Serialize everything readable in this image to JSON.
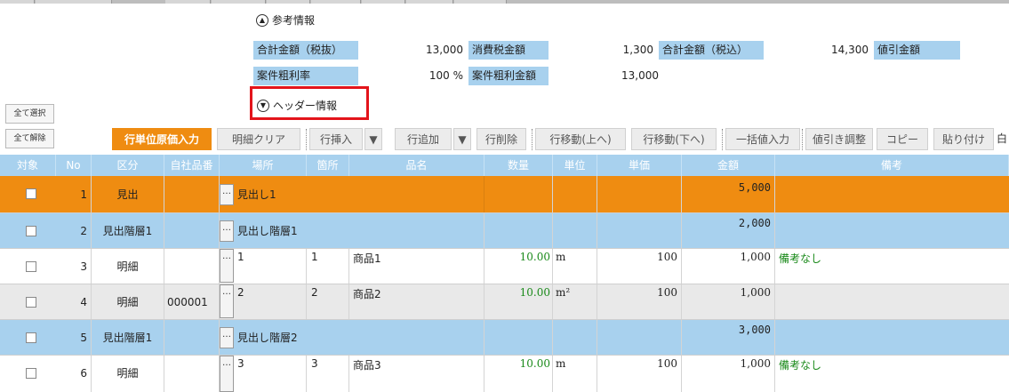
{
  "reference_section": {
    "title": "参考情報"
  },
  "summary": {
    "subtotal_label": "合計金額（税抜）",
    "subtotal_value": "13,000",
    "tax_label": "消費税金額",
    "tax_value": "1,300",
    "total_label": "合計金額（税込）",
    "total_value": "14,300",
    "discount_label": "値引金額",
    "margin_rate_label": "案件粗利率",
    "margin_rate_value": "100 %",
    "margin_amount_label": "案件粗利金額",
    "margin_amount_value": "13,000"
  },
  "header_section": {
    "title": "ヘッダー情報"
  },
  "left_buttons": {
    "select_all": "全て選択",
    "deselect_all": "全て解除"
  },
  "toolbar": {
    "cost_input": "行単位原価入力",
    "clear_details": "明細クリア",
    "insert_row": "行挿入",
    "add_row": "行追加",
    "delete_row": "行削除",
    "move_up": "行移動(上へ)",
    "move_down": "行移動(下へ)",
    "bulk_input": "一括値入力",
    "discount_adjust": "値引き調整",
    "copy": "コピー",
    "paste": "貼り付け",
    "overflow": "白"
  },
  "grid": {
    "headers": {
      "target": "対象",
      "no": "No",
      "category": "区分",
      "product_code": "自社品番",
      "place": "場所",
      "location": "箇所",
      "item_name": "品名",
      "quantity": "数量",
      "unit": "単位",
      "unit_price": "単価",
      "amount": "金額",
      "remarks": "備考"
    },
    "rows": [
      {
        "no": "1",
        "category": "見出",
        "place": "見出し1",
        "amount": "5,000",
        "style": "orange"
      },
      {
        "no": "2",
        "category": "見出階層1",
        "place": "見出し階層1",
        "amount": "2,000",
        "style": "blue"
      },
      {
        "no": "3",
        "category": "明細",
        "product_code": "",
        "place": "1",
        "location": "1",
        "item_name": "商品1",
        "quantity": "10.00",
        "unit": "m",
        "unit_price": "100",
        "amount": "1,000",
        "remarks": "備考なし",
        "style": "white"
      },
      {
        "no": "4",
        "category": "明細",
        "product_code": "000001",
        "place": "2",
        "location": "2",
        "item_name": "商品2",
        "quantity": "10.00",
        "unit": "m²",
        "unit_price": "100",
        "amount": "1,000",
        "remarks": "",
        "style": "gray"
      },
      {
        "no": "5",
        "category": "見出階層1",
        "place": "見出し階層2",
        "amount": "3,000",
        "style": "blue"
      },
      {
        "no": "6",
        "category": "明細",
        "product_code": "",
        "place": "3",
        "location": "3",
        "item_name": "商品3",
        "quantity": "10.00",
        "unit": "m",
        "unit_price": "100",
        "amount": "1,000",
        "remarks": "備考なし",
        "style": "white"
      }
    ]
  },
  "colors": {
    "accent_orange": "#ef8c11",
    "heading_blue": "#a8d1ee",
    "highlight_red": "#e3141b",
    "quantity_green": "#1a8a1a"
  }
}
